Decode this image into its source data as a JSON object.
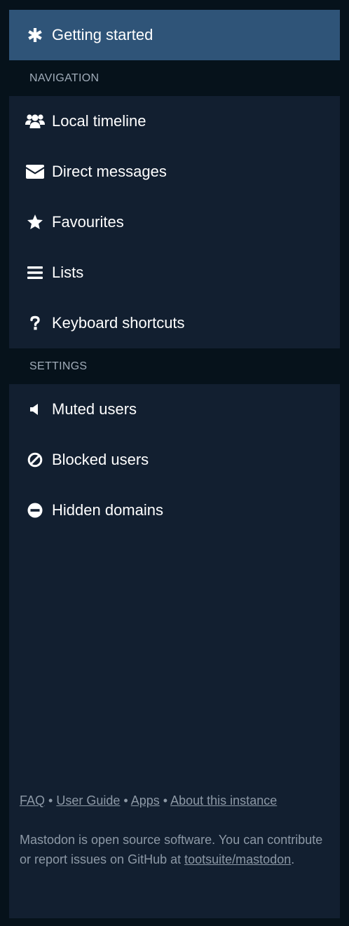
{
  "header": {
    "label": "Getting started",
    "icon": "asterisk-icon"
  },
  "navigation": {
    "heading": "NAVIGATION",
    "items": [
      {
        "label": "Local timeline",
        "icon": "users-icon"
      },
      {
        "label": "Direct messages",
        "icon": "envelope-icon"
      },
      {
        "label": "Favourites",
        "icon": "star-icon"
      },
      {
        "label": "Lists",
        "icon": "list-icon"
      },
      {
        "label": "Keyboard shortcuts",
        "icon": "question-icon"
      }
    ]
  },
  "settings": {
    "heading": "SETTINGS",
    "items": [
      {
        "label": "Muted users",
        "icon": "volume-off-icon"
      },
      {
        "label": "Blocked users",
        "icon": "ban-icon"
      },
      {
        "label": "Hidden domains",
        "icon": "minus-circle-icon"
      }
    ]
  },
  "footer": {
    "links": [
      "FAQ",
      "User Guide",
      "Apps",
      "About this instance"
    ],
    "separator": "•",
    "text_before": "Mastodon is open source software. You can contribute or report issues on GitHub at",
    "repo_link": "tootsuite/mastodon",
    "text_after": "."
  },
  "colors": {
    "background": "#06121b",
    "panel": "#121f30",
    "active": "#2f5478",
    "heading_text": "#a0acb9",
    "footer_text": "#8d99a6"
  }
}
